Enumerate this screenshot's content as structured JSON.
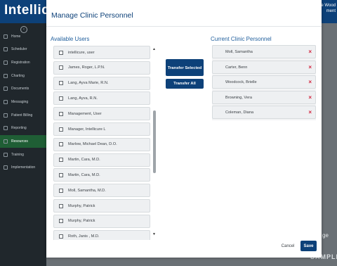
{
  "app": {
    "logo_text": "Intellicure",
    "user_greeting_line1": "Hello Brielle Wood",
    "user_greeting_line2": "ment"
  },
  "sidebar": {
    "items": [
      {
        "label": "Home",
        "icon": "home-icon"
      },
      {
        "label": "Scheduler",
        "icon": "calendar-icon"
      },
      {
        "label": "Registration",
        "icon": "registration-icon"
      },
      {
        "label": "Charting",
        "icon": "chart-icon"
      },
      {
        "label": "Documents",
        "icon": "document-icon"
      },
      {
        "label": "Messaging",
        "icon": "mail-icon"
      },
      {
        "label": "Patient Billing",
        "icon": "billing-icon"
      },
      {
        "label": "Reporting",
        "icon": "report-icon"
      },
      {
        "label": "Resources",
        "icon": "resources-icon",
        "active": true
      },
      {
        "label": "Training",
        "icon": "training-icon"
      },
      {
        "label": "Implementation",
        "icon": "implementation-icon"
      }
    ]
  },
  "background": {
    "right_edge_text": "ge",
    "watermark": "SAMPLE"
  },
  "modal": {
    "title": "Manage Clinic Personnel",
    "available_label": "Available Users",
    "current_label": "Current Clinic Personnel",
    "available_users": [
      "intellicure, user",
      "James, Roger, L.P.N.",
      "Lang, Ayva Marie, R.N.",
      "Lang, Ayva, R.N.",
      "Management, User",
      "Manager, Intellicure L",
      "Marlow, Michael Dean, D.O.",
      "Martin, Cara, M.D.",
      "Martin, Cara, M.D.",
      "Moll, Samantha, M.D.",
      "Murphy, Patrick",
      "Murphy, Patrick",
      "Roth, Janis , M.D."
    ],
    "current_personnel": [
      "Moll, Samantha",
      "Carter, Benn",
      "Woodcock, Brielle",
      "Browning, Vera",
      "Coleman, Diana"
    ],
    "transfer_selected_label": "Transfer Selected",
    "transfer_all_label": "Transfer All",
    "cancel_label": "Cancel",
    "save_label": "Save",
    "remove_icon_glyph": "×"
  },
  "colors": {
    "primary": "#0d4179",
    "remove": "#d2223c",
    "sidebar_active": "#1f5e35"
  }
}
